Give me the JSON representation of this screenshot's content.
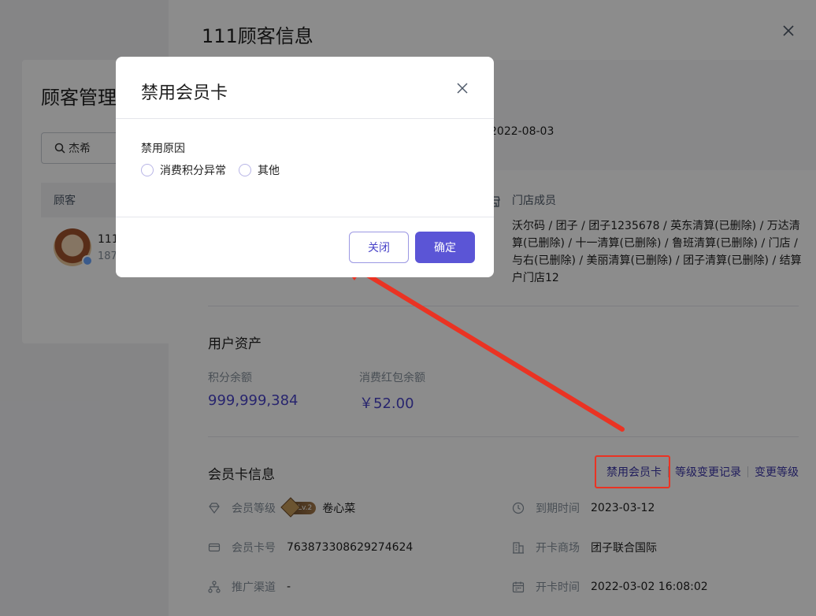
{
  "background_page": {
    "title": "顾客管理",
    "search_value": "杰希",
    "table_header": "顾客",
    "row_name": "111",
    "row_phone": "187"
  },
  "drawer": {
    "title": "111顾客信息",
    "open_date": "2022-08-03",
    "store_members_label": "门店成员",
    "store_members_text": "沃尔码 / 团子 / 团子1235678 / 英东清算(已删除) / 万达清算(已删除) / 十一清算(已删除) / 鲁班清算(已删除) / 门店 / 与右(已删除) / 美丽清算(已删除) / 团子清算(已删除) / 结算户门店12",
    "assets": {
      "title": "用户资产",
      "points_label": "积分余额",
      "points_value": "999,999,384",
      "redpack_label": "消费红包余额",
      "redpack_value": "￥52.00"
    },
    "card": {
      "title": "会员卡信息",
      "actions": {
        "disable": "禁用会员卡",
        "level_history": "等级变更记录",
        "change_level": "变更等级"
      },
      "level_label": "会员等级",
      "level_badge": "Lv.2",
      "level_value": "卷心菜",
      "card_no_label": "会员卡号",
      "card_no_value": "763873308629274624",
      "channel_label": "推广渠道",
      "channel_value": "-",
      "expire_label": "到期时间",
      "expire_value": "2023-03-12",
      "mall_label": "开卡商场",
      "mall_value": "团子联合国际",
      "open_time_label": "开卡时间",
      "open_time_value": "2022-03-02 16:08:02"
    }
  },
  "modal": {
    "title": "禁用会员卡",
    "reason_label": "禁用原因",
    "options": [
      "消费积分异常",
      "其他"
    ],
    "cancel_label": "关闭",
    "ok_label": "确定"
  },
  "colors": {
    "accent": "#5b55d6",
    "annotation_red": "#ea3323"
  }
}
